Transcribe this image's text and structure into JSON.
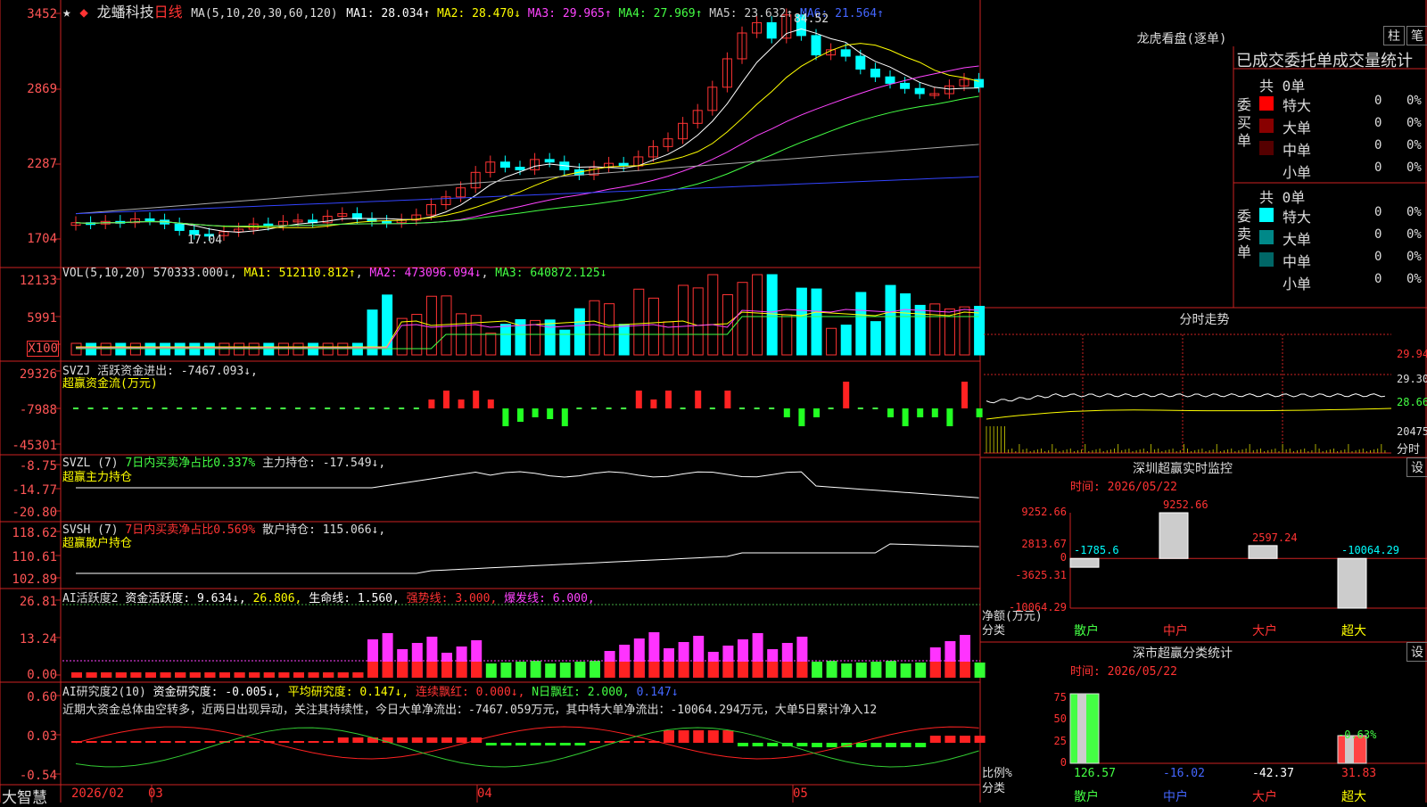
{
  "stock": {
    "name": "龙蟠科技",
    "period": "日线",
    "star": "★",
    "diamond": "◆"
  },
  "main_chart": {
    "ma_title": "MA(5,10,20,30,60,120)",
    "ma_values": [
      {
        "label": "MA1: 28.034↑",
        "color": "#ffffff"
      },
      {
        "label": "MA2: 28.470↓",
        "color": "#ffff00"
      },
      {
        "label": "MA3: 29.965↑",
        "color": "#ff44ff"
      },
      {
        "label": "MA4: 27.969↑",
        "color": "#44ff44"
      },
      {
        "label": "MA5: 23.632↑",
        "color": "#cccccc"
      },
      {
        "label": "MA6: 21.564↑",
        "color": "#4466ff"
      }
    ],
    "price_labels": [
      "3452",
      "2869",
      "2287",
      "1704"
    ],
    "high_annotation": "84.52",
    "low_annotation": "17.04"
  },
  "vol_panel": {
    "title": "VOL(5,10,20)",
    "value": "570333.000↓",
    "ma1": "MA1: 512110.812↑",
    "ma2": "MA2: 473096.094↓",
    "ma3": "MA3: 640872.125↓",
    "labels": [
      "12133",
      "5991",
      "X100"
    ]
  },
  "svzj_panel": {
    "title": "SVZJ",
    "item": "活跃资金进出: -7467.093↓,",
    "subtitle": "超赢资金流(万元)",
    "labels": [
      "29326",
      "-7988",
      "-45301"
    ]
  },
  "svzl_panel": {
    "title": "SVZL (7)",
    "seven_day": "7日内买卖净占比0.337%",
    "main": "主力持仓: -17.549↓,",
    "subtitle": "超赢主力持仓",
    "labels": [
      "-8.75",
      "-14.77",
      "-20.80"
    ]
  },
  "svsh_panel": {
    "title": "SVSH (7)",
    "seven_day": "7日内买卖净占比0.569%",
    "retail": "散户持仓: 115.066↓,",
    "subtitle": "超赢散户持仓",
    "labels": [
      "118.62",
      "110.61",
      "102.89"
    ]
  },
  "ai_active_panel": {
    "title": "AI活跃度2",
    "items": [
      {
        "label": "资金活跃度: 9.634↓,",
        "color": "#ffffff"
      },
      {
        "label": "26.806,",
        "color": "#ffff00"
      },
      {
        "label": "生命线: 1.560,",
        "color": "#ffffff"
      },
      {
        "label": "强势线: 3.000,",
        "color": "#ff3333"
      },
      {
        "label": "爆发线: 6.000,",
        "color": "#ff44ff"
      }
    ],
    "labels": [
      "26.81",
      "13.24",
      "0.00"
    ]
  },
  "ai_research_panel": {
    "title": "AI研究度2(10)",
    "items": [
      {
        "label": "资金研究度: -0.005↓,",
        "color": "#ffffff"
      },
      {
        "label": "平均研究度: 0.147↓,",
        "color": "#ffff00"
      },
      {
        "label": "连续飘红: 0.000↓,",
        "color": "#ff3333"
      },
      {
        "label": "N日飘红: 2.000,",
        "color": "#44ff44"
      },
      {
        "label": "0.147↓",
        "color": "#4466ff"
      }
    ],
    "comment": "近期大资金总体由空转多，近两日出现异动，关注其持续性，今日大单净流出：-7467.059万元，其中特大单净流出：-10064.294万元，大单5日累计净入12",
    "labels": [
      "0.60",
      "0.03",
      "-0.54"
    ]
  },
  "time_axis": {
    "app_name": "大智慧",
    "labels": [
      "2026/02",
      "03",
      "04",
      "05"
    ]
  },
  "dragon_tiger": {
    "title": "龙虎看盘(逐单)",
    "btn_zhu": "柱",
    "btn_bi": "笔",
    "subtitle": "已成交委托单成交量统计",
    "buy": {
      "side_label": "委买单",
      "total": "共 0单",
      "rows": [
        {
          "name": "特大",
          "value": "0",
          "pct": "0%",
          "color": "#ff0000"
        },
        {
          "name": "大单",
          "value": "0",
          "pct": "0%",
          "color": "#880000"
        },
        {
          "name": "中单",
          "value": "0",
          "pct": "0%",
          "color": "#550000"
        },
        {
          "name": "小单",
          "value": "0",
          "pct": "0%",
          "color": ""
        }
      ]
    },
    "sell": {
      "side_label": "委卖单",
      "total": "共 0单",
      "rows": [
        {
          "name": "特大",
          "value": "0",
          "pct": "0%",
          "color": "#00ffff"
        },
        {
          "name": "大单",
          "value": "0",
          "pct": "0%",
          "color": "#008888"
        },
        {
          "name": "中单",
          "value": "0",
          "pct": "0%",
          "color": "#006666"
        },
        {
          "name": "小单",
          "value": "0",
          "pct": "0%",
          "color": ""
        }
      ]
    }
  },
  "intraday": {
    "title": "分时走势",
    "labels": [
      "29.94",
      "29.30",
      "28.66",
      "20475"
    ],
    "bottom_label": "分时"
  },
  "realtime_monitor": {
    "title": "深圳超赢实时监控",
    "btn": "设",
    "time": "时间: 2026/05/22",
    "y_labels": [
      "9252.66",
      "2813.67",
      "0",
      "-3625.31",
      "-10064.29"
    ],
    "net_label": "净额(万元)",
    "cat_label": "分类",
    "chart_data": {
      "type": "bar",
      "categories": [
        "散户",
        "中户",
        "大户",
        "超大"
      ],
      "values": [
        -1785.6,
        9252.66,
        2597.24,
        -10064.29
      ],
      "ylim": [
        -10064.29,
        9252.66
      ]
    }
  },
  "class_stats": {
    "title": "深市超赢分类统计",
    "btn": "设",
    "time": "时间: 2026/05/22",
    "y_labels": [
      "75",
      "50",
      "25",
      "0"
    ],
    "ratio_label": "比例%",
    "cat_label": "分类",
    "chart_data": {
      "type": "bar",
      "categories": [
        "散户",
        "中户",
        "大户",
        "超大"
      ],
      "values": [
        126.57,
        -16.02,
        -42.37,
        31.83
      ],
      "value_colors": [
        "#44ff44",
        "#4466ff",
        "#ffffff",
        "#ff3333"
      ],
      "extra_label": "-0.63%",
      "ylim": [
        0,
        75
      ]
    }
  }
}
